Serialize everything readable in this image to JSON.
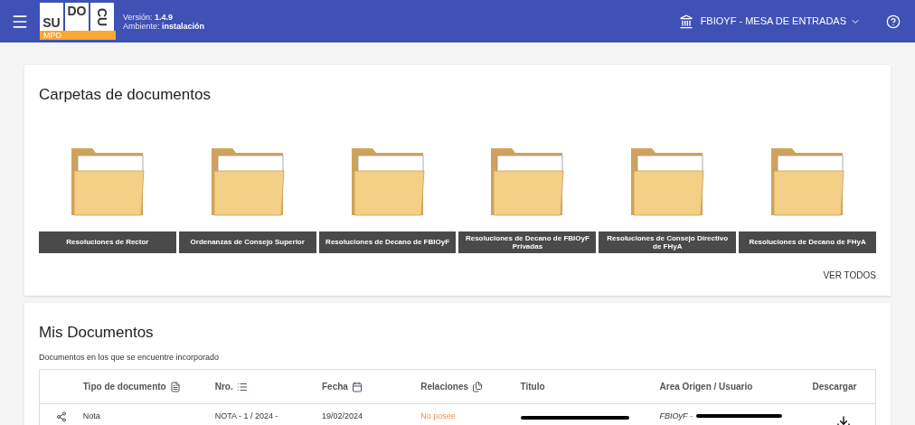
{
  "header": {
    "logo": {
      "letters": [
        "SU",
        "DO",
        "CU"
      ],
      "tag": "MPD"
    },
    "version_label": "Versión:",
    "version": "1.4.9",
    "env_label": "Ambiente:",
    "env": "instalación",
    "office": "FBIOYF - MESA DE ENTRADAS"
  },
  "folders": {
    "title": "Carpetas de documentos",
    "items": [
      {
        "label": "Resoluciones de Rector"
      },
      {
        "label": "Ordenanzas de Consejo Superior"
      },
      {
        "label": "Resoluciones de Decano de FBIOyF"
      },
      {
        "label": "Resoluciones de Decano de FBIOyF Privadas"
      },
      {
        "label": "Resoluciones de Consejo Directivo de FHyA"
      },
      {
        "label": "Resoluciones de Decano de FHyA"
      }
    ],
    "see_all": "VER TODOS"
  },
  "documents": {
    "title": "Mis Documentos",
    "subtitle": "Documentos en los que se encuentre incorporado",
    "columns": [
      {
        "label": "Tipo de documento",
        "kind": "type"
      },
      {
        "label": "Nro.",
        "kind": "number"
      },
      {
        "label": "Fecha",
        "kind": "date"
      },
      {
        "label": "Relaciones",
        "kind": "relations"
      },
      {
        "label": "Titulo",
        "kind": "plain"
      },
      {
        "label": "Area Origen / Usuario",
        "kind": "plain"
      },
      {
        "label": "Descargar",
        "kind": "plain"
      }
    ],
    "rows": [
      {
        "type": "Nota",
        "number": "NOTA - 1 / 2024 -",
        "date": "19/02/2024",
        "relations": "No posee",
        "origin": "FBIOyF -"
      }
    ]
  }
}
